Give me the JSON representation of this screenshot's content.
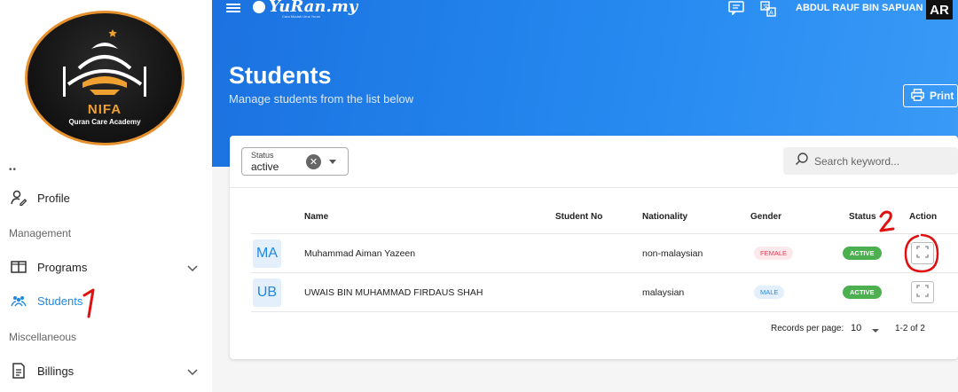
{
  "sidebar": {
    "logo": {
      "title": "NIFA",
      "subtitle": "Quran Care Academy"
    },
    "partial_item": "••",
    "items": [
      {
        "label": "Profile",
        "icon": "user-edit-icon"
      },
      {
        "label": "Programs",
        "icon": "book-open-icon"
      },
      {
        "label": "Students",
        "icon": "people-group-icon",
        "active": true
      },
      {
        "label": "Billings",
        "icon": "receipt-icon"
      }
    ],
    "sections": {
      "management": "Management",
      "misc": "Miscellaneous"
    }
  },
  "topbar": {
    "brand": "YuRan.my",
    "brand_tagline": "Cara Mudah Urus Yuran",
    "user_name": "ABDUL RAUF BIN SAPUAN",
    "user_initials": "AR"
  },
  "header": {
    "title": "Students",
    "subtitle": "Manage students from the list below",
    "print_label": "Print"
  },
  "filters": {
    "status_label": "Status",
    "status_value": "active",
    "search_placeholder": "Search keyword..."
  },
  "table": {
    "headers": {
      "name": "Name",
      "student_no": "Student No",
      "nationality": "Nationality",
      "gender": "Gender",
      "status": "Status",
      "action": "Action"
    },
    "rows": [
      {
        "initials": "MA",
        "name": "Muhammad Aiman Yazeen",
        "student_no": "",
        "nationality": "non-malaysian",
        "gender": "FEMALE",
        "status": "ACTIVE"
      },
      {
        "initials": "UB",
        "name": "UWAIS BIN MUHAMMAD FIRDAUS SHAH",
        "student_no": "",
        "nationality": "malaysian",
        "gender": "MALE",
        "status": "ACTIVE"
      }
    ]
  },
  "pagination": {
    "records_label": "Records per page:",
    "per_page": "10",
    "range": "1-2 of 2"
  },
  "annotations": {
    "one": "1",
    "two": "2"
  },
  "colors": {
    "primary": "#1e88e5",
    "active_green": "#4caf50",
    "female_pink": "#e53955",
    "annotation_red": "#e01010"
  }
}
